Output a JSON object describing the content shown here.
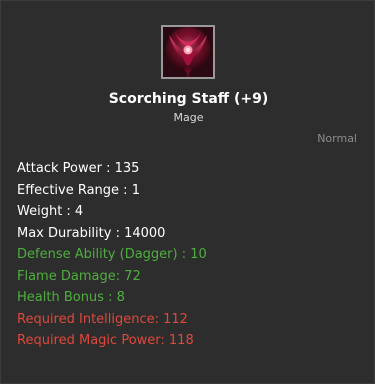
{
  "item": {
    "icon": "scorching-staff-icon",
    "name": "Scorching Staff (+9)",
    "class": "Mage",
    "grade": "Normal"
  },
  "stats": [
    {
      "text": "Attack Power : 135",
      "color": "#ffffff"
    },
    {
      "text": "Effective Range : 1",
      "color": "#ffffff"
    },
    {
      "text": "Weight : 4",
      "color": "#ffffff"
    },
    {
      "text": "Max Durability : 14000",
      "color": "#ffffff"
    },
    {
      "text": "Defense Ability (Dagger) : 10",
      "color": "#4fae3f"
    },
    {
      "text": "Flame Damage: 72",
      "color": "#4fae3f"
    },
    {
      "text": "Health Bonus : 8",
      "color": "#4fae3f"
    },
    {
      "text": "Required Intelligence: 112",
      "color": "#e0483a"
    },
    {
      "text": "Required Magic Power: 118",
      "color": "#e0483a"
    }
  ]
}
